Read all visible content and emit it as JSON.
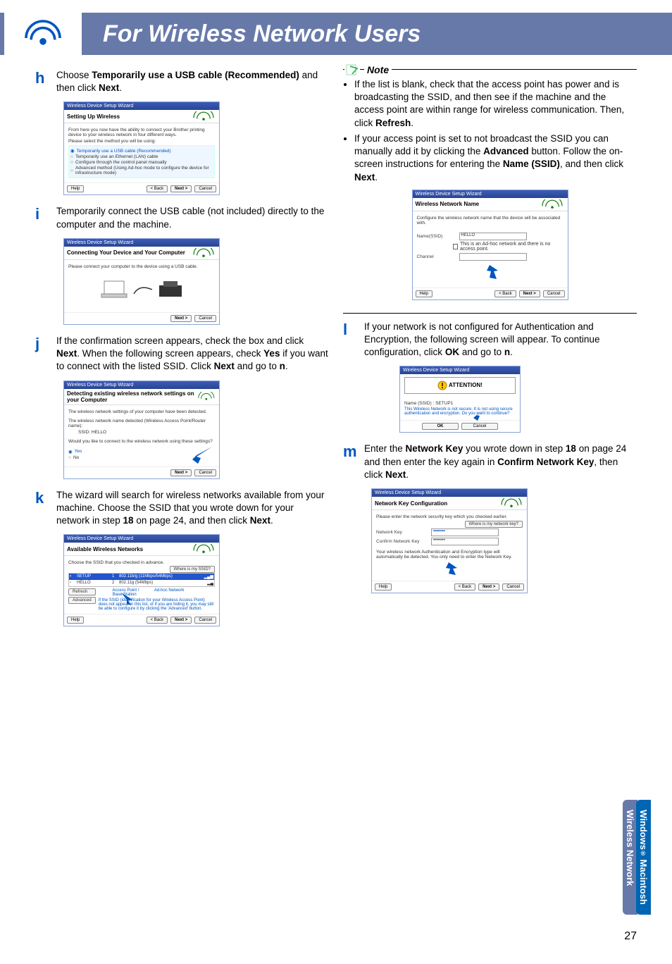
{
  "headerTitle": "For Wireless Network Users",
  "pageNumber": "27",
  "sideTabs": {
    "a": "Windows",
    "aSuffix": " Macintosh",
    "b": "Wireless Network"
  },
  "step_h": {
    "pre": "Choose ",
    "bold1": "Temporarily use a USB cable (Recommended)",
    "mid": " and then click ",
    "bold2": "Next",
    "post": "."
  },
  "dlg1": {
    "bar": "Wireless Device Setup Wizard",
    "title": "Setting Up Wireless",
    "intro": "From here you now have the ability to connect your Brother printing device to your wireless network in four different ways.",
    "sub": "Please select the method you will be using:",
    "opts": [
      "Temporarily use a USB cable (Recommended)",
      "Temporarily use an Ethernet (LAN) cable",
      "Configure through the control panel manually",
      "Advanced method (Using Ad-hoc mode to configure the device for infrastructure mode)"
    ],
    "help": "Help",
    "back": "< Back",
    "next": "Next >",
    "cancel": "Cancel"
  },
  "step_i": "Temporarily connect the USB cable (not included) directly to the computer and the machine.",
  "dlg2": {
    "bar": "Wireless Device Setup Wizard",
    "title": "Connecting Your Device and Your Computer",
    "sub": "Please connect your computer to the device using a USB cable.",
    "next": "Next >",
    "cancel": "Cancel"
  },
  "step_j": {
    "t1": "If the confirmation screen appears, check the box and click ",
    "b1": "Next",
    "t2": ". When the following screen appears, check ",
    "b2": "Yes",
    "t3": " if you want to connect with the listed SSID. Click ",
    "b3": "Next",
    "t4": " and go to ",
    "b4": "n",
    "t5": "."
  },
  "dlg3": {
    "bar": "Wireless Device Setup Wizard",
    "title": "Detecting existing wireless network settings on your Computer",
    "l1": "The wireless network settings of your computer have been detected.",
    "l2": "The wireless network name detected (Wireless Access Point/Router name):",
    "ssidLabel": "SSID:",
    "ssid": "HELLO",
    "q": "Would you like to connect to the wireless network using these settings?",
    "yes": "Yes",
    "no": "No",
    "next": "Next >",
    "cancel": "Cancel"
  },
  "step_k": {
    "t1": "The wizard will search for wireless networks available from your machine. Choose the SSID that you wrote down for your network in step ",
    "b1": "18",
    "t2": " on page 24, and then click ",
    "b2": "Next",
    "t3": "."
  },
  "dlg4": {
    "bar": "Wireless Device Setup Wizard",
    "title": "Available Wireless Networks",
    "sub": "Choose the SSID that you checked in advance.",
    "where": "Where is my SSID?",
    "row1n": "SETUP",
    "row1s": "802.11b/g (11Mbps/54Mbps)",
    "row2n": "HELLO",
    "row2s": "802.11g (54Mbps)",
    "refresh": "Refresh",
    "advanced": "Advanced",
    "leg": "            Access Point /             Ad-hoc Network\n            Base Station",
    "tip": "If the SSID (Identification for your Wireless Access Point) does not appear in this list, or if you are hiding it, you may still be able to configure it by clicking the 'Advanced' button.",
    "help": "Help",
    "back": "< Back",
    "next": "Next >",
    "cancel": "Cancel"
  },
  "note": {
    "label": "Note",
    "b1a": "If the list is blank, check that the access point has power and is broadcasting the SSID, and then see if the machine and the access point are within range for wireless communication. Then, click ",
    "b1b": "Refresh",
    "b1c": ".",
    "b2a": "If your access point is set to not broadcast the SSID you can manually add it by clicking the ",
    "b2b": "Advanced",
    "b2c": " button. Follow the on-screen instructions for entering the ",
    "b2d": "Name (SSID)",
    "b2e": ", and then click ",
    "b2f": "Next",
    "b2g": "."
  },
  "dlg5": {
    "bar": "Wireless Device Setup Wizard",
    "title": "Wireless Network Name",
    "sub": "Configure the wireless network name that the device will be associated with.",
    "nameLbl": "Name(SSID)",
    "name": "HELLO",
    "chk": "This is an Ad-hoc network and there is no access point.",
    "chanLbl": "Channel",
    "help": "Help",
    "back": "< Back",
    "next": "Next >",
    "cancel": "Cancel"
  },
  "step_l": {
    "t1": "If your network is not configured for Authentication and Encryption, the following screen will appear. To continue configuration, click ",
    "b1": "OK",
    "t2": " and go to ",
    "b2": "n",
    "t3": "."
  },
  "dlg6": {
    "bar": "Wireless Device Setup Wizard",
    "att": "ATTENTION!",
    "l1": "Name (SSID) :",
    "l1v": "SETUP1",
    "body": "This Wireless Network is not secure. It is not using secure authentication and encryption. Do you want to continue?",
    "ok": "OK",
    "cancel": "Cancel"
  },
  "step_m": {
    "t1": "Enter the ",
    "b1": "Network Key",
    "t2": " you wrote down in step ",
    "b2": "18",
    "t3": " on page 24 and then enter the key again in ",
    "b3": "Confirm Network Key",
    "t4": ", then click ",
    "b4": "Next",
    "t5": "."
  },
  "dlg7": {
    "bar": "Wireless Device Setup Wizard",
    "title": "Network Key Configuration",
    "sub": "Please enter the network security key which you checked earlier.",
    "where": "Where is my network key?",
    "l1": "Network Key",
    "l2": "Confirm Network Key",
    "v": "••••••••",
    "tip": "Your wireless network Authentication and Encryption type will automatically be detected. You only need to enter the Network Key.",
    "help": "Help",
    "back": "< Back",
    "next": "Next >",
    "cancel": "Cancel"
  }
}
